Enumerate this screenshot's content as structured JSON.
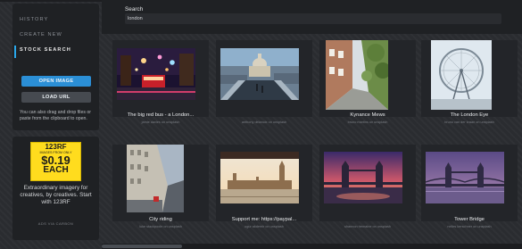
{
  "sidebar": {
    "nav": [
      {
        "label": "HISTORY",
        "active": false
      },
      {
        "label": "CREATE NEW",
        "active": false
      },
      {
        "label": "STOCK SEARCH",
        "active": true
      }
    ],
    "open_image_label": "OPEN IMAGE",
    "load_url_label": "LOAD URL",
    "hint": "You can also drag and drop files or paste from the clipboard to open."
  },
  "ad": {
    "brand": "123RF",
    "subline": "IMAGES FROM ONLY",
    "price": "$0.19",
    "each": "EACH",
    "text": "Extraordinary imagery for creatives, by creatives. Start with 123RF",
    "via": "ADS VIA CARBON"
  },
  "search": {
    "label": "Search",
    "value": "london"
  },
  "gallery": [
    {
      "title": "The big red bus - a London...",
      "credit": "jamie davies on unsplash",
      "icon": "night-street-photo"
    },
    {
      "title": "",
      "credit": "anthony delanoix on unsplash",
      "icon": "st-pauls-bridge-photo"
    },
    {
      "title": "Kynance Mews",
      "credit": "bruno martins on unsplash",
      "icon": "mews-street-photo"
    },
    {
      "title": "The London Eye",
      "credit": "bruno van der kraan on unsplash",
      "icon": "london-eye-photo"
    },
    {
      "title": "City riding",
      "credit": "luke stackpoole on unsplash",
      "icon": "regent-street-photo"
    },
    {
      "title": "Support me: https://paypal...",
      "credit": "ugur akdemir on unsplash",
      "icon": "westminster-photo"
    },
    {
      "title": "",
      "credit": "shannon tremaine on unsplash",
      "icon": "tower-bridge-sunset-photo"
    },
    {
      "title": "Tower Bridge",
      "credit": "nelles kerschner on unsplash",
      "icon": "tower-bridge-dusk-photo"
    }
  ],
  "colors": {
    "accent": "#2b8fd6",
    "panel": "#1f2124",
    "background": "#2a2c30"
  }
}
